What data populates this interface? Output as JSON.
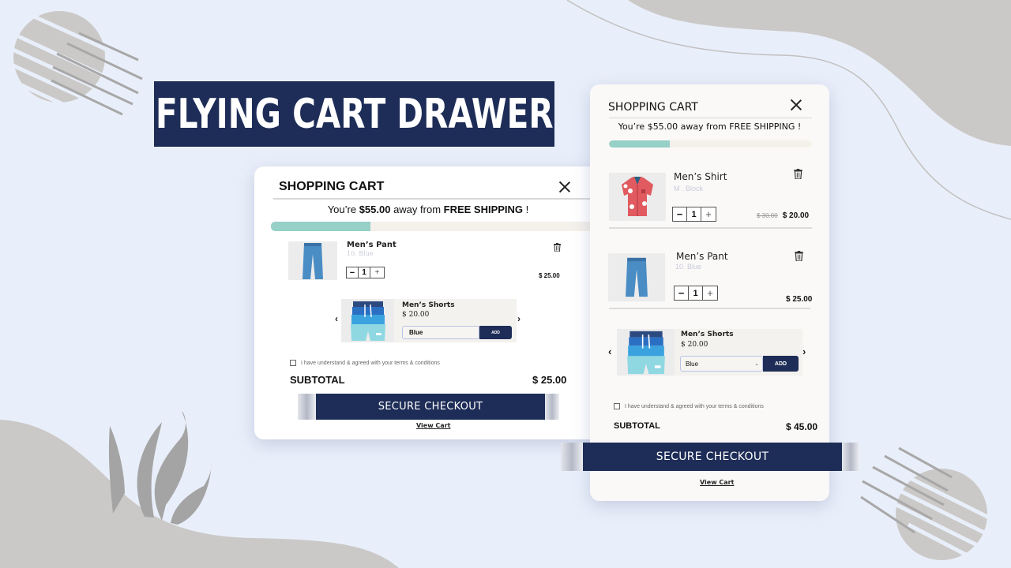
{
  "banner": {
    "title": "FLYING CART DRAWER"
  },
  "colors": {
    "navy": "#1e2d57",
    "progress_fill": "#96d0c7",
    "progress_track": "#f4f0ea",
    "background": "#e9effa",
    "decor_gray": "#cbc9c7"
  },
  "cart_left": {
    "title": "SHOPPING CART",
    "shipping_prefix": "You’re ",
    "shipping_amount": "$55.00",
    "shipping_mid": " away from ",
    "shipping_free": "FREE SHIPPING",
    "shipping_suffix": " !",
    "progress_percent": 30,
    "items": [
      {
        "name": "Men’s Pant",
        "variant": "10. Blue",
        "quantity": "1",
        "minus": "−",
        "plus": "+",
        "price": "$ 25.00",
        "icon": "pants-image"
      }
    ],
    "upsell": {
      "name": "Men’s Shorts",
      "price": "$ 20.00",
      "variant_selected": "Blue",
      "add_label": "ADD",
      "prev": "‹",
      "next": "›"
    },
    "terms": "I have understand & agreed with your terms & conditions",
    "subtotal_label": "SUBTOTAL",
    "subtotal_value": "$ 25.00",
    "checkout_label": "SECURE CHECKOUT",
    "view_cart": "View Cart"
  },
  "cart_right": {
    "title": "SHOPPING CART",
    "shipping_text": "You’re $55.00 away from FREE SHIPPING !",
    "progress_percent": 30,
    "items": [
      {
        "name": "Men’s Shirt",
        "variant": "M . Block",
        "quantity": "1",
        "minus": "−",
        "plus": "+",
        "old_price": "$ 30.00",
        "price": "$ 20.00",
        "icon": "shirt-image"
      },
      {
        "name": "Men’s Pant",
        "variant": "10. Blue",
        "quantity": "1",
        "minus": "−",
        "plus": "+",
        "price": "$ 25.00",
        "icon": "pants-image"
      }
    ],
    "upsell": {
      "name": "Men’s Shorts",
      "price": "$ 20.00",
      "variant_selected": "Blue",
      "add_label": "ADD",
      "prev": "‹",
      "next": "›"
    },
    "terms": "I have understand & agreed with your terms & conditions",
    "subtotal_label": "SUBTOTAL",
    "subtotal_value": "$ 45.00",
    "checkout_label": "SECURE CHECKOUT",
    "view_cart": "View Cart"
  }
}
